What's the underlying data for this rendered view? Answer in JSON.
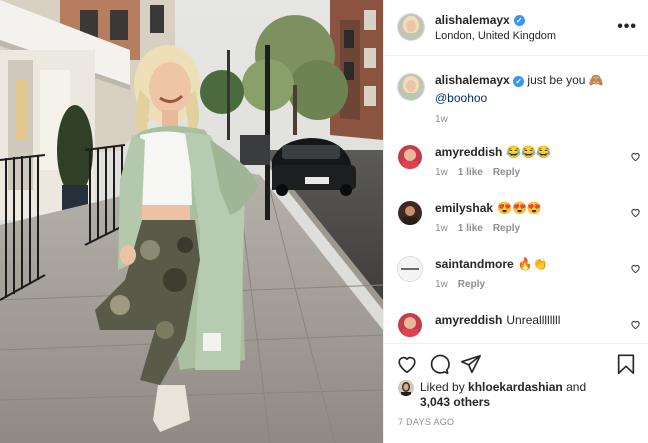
{
  "header": {
    "username": "alishalemayx",
    "location": "London, United Kingdom",
    "more_label": "•••"
  },
  "caption": {
    "username": "alishalemayx",
    "text": "just be you 🙈",
    "mention": "@boohoo",
    "time": "1w"
  },
  "comments": [
    {
      "username": "amyreddish",
      "text": "😂😂😂",
      "time": "1w",
      "likes": "1 like",
      "reply": "Reply"
    },
    {
      "username": "emilyshak",
      "text": "😍😍😍",
      "time": "1w",
      "likes": "1 like",
      "reply": "Reply"
    },
    {
      "username": "saintandmore",
      "text": "🔥👏",
      "time": "1w",
      "likes": "",
      "reply": "Reply"
    },
    {
      "username": "amyreddish",
      "text": "Unreallllllll",
      "time": "",
      "likes": "",
      "reply": ""
    }
  ],
  "likes": {
    "prefix": "Liked by",
    "liker": "khloekardashian",
    "conjunction": "and",
    "others": "3,043 others"
  },
  "post_time": "7 DAYS AGO",
  "icons": {
    "verified": "verified-badge-icon",
    "like": "heart-icon",
    "comment": "comment-icon",
    "share": "share-icon",
    "save": "bookmark-icon"
  },
  "colors": {
    "verified": "#3897f0",
    "meta_gray": "#8e8e8e",
    "border": "#efefef",
    "coat": "#a9bfa0"
  }
}
